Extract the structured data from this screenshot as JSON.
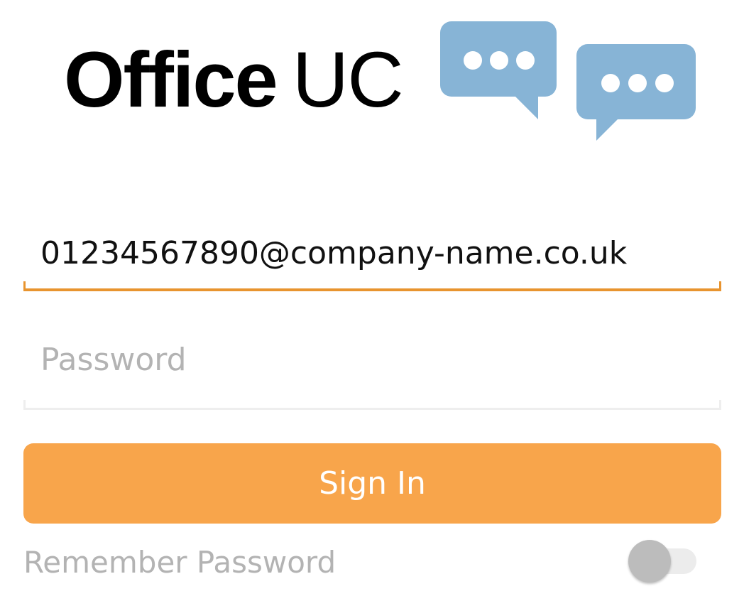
{
  "app": {
    "logo_bold": "Office",
    "logo_light": "UC",
    "logo_icon": "chat-bubbles-icon",
    "bubble_color": "#87b4d6"
  },
  "login": {
    "username_value": "01234567890@company-name.co.uk",
    "password_placeholder": "Password",
    "password_value": "",
    "sign_in_label": "Sign In",
    "remember_label": "Remember Password",
    "remember_enabled": false
  },
  "colors": {
    "accent": "#f8a54b",
    "focus_underline": "#e8942f",
    "muted_text": "#b3b3b3"
  }
}
